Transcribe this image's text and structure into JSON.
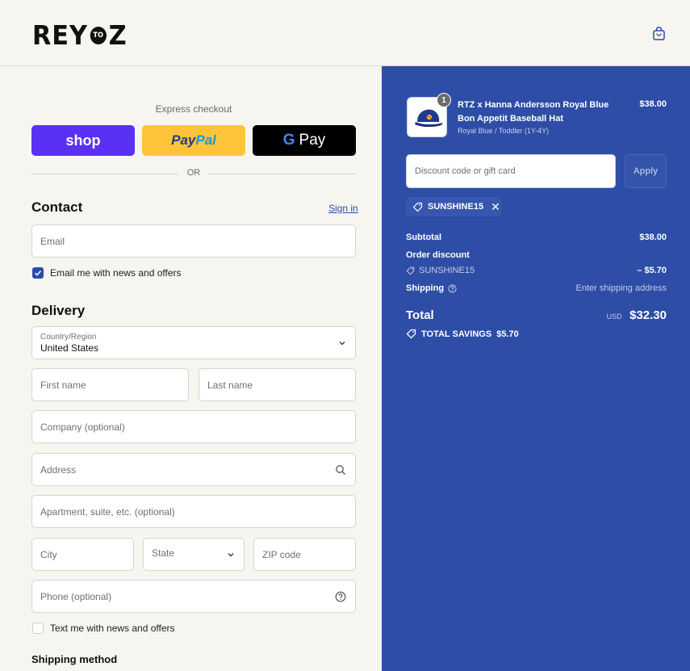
{
  "header": {
    "logo_left": "REY",
    "logo_middle": "TO",
    "logo_right": "Z",
    "cart_icon": "shopping-bag-icon"
  },
  "express": {
    "label": "Express checkout",
    "shop_label": "shop",
    "paypal_part1": "Pay",
    "paypal_part2": "Pal",
    "gpay_g": "G",
    "gpay_label": "Pay",
    "or_label": "OR"
  },
  "contact": {
    "heading": "Contact",
    "signin": "Sign in",
    "email_placeholder": "Email",
    "news_label": "Email me with news and offers",
    "news_checked": true
  },
  "delivery": {
    "heading": "Delivery",
    "country_label": "Country/Region",
    "country_value": "United States",
    "first_name": "First name",
    "last_name": "Last name",
    "company": "Company (optional)",
    "address": "Address",
    "apartment": "Apartment, suite, etc. (optional)",
    "city": "City",
    "state": "State",
    "zip": "ZIP code",
    "phone": "Phone (optional)",
    "text_label": "Text me with news and offers",
    "text_checked": false
  },
  "shipping_method": {
    "heading": "Shipping method"
  },
  "summary": {
    "product": {
      "quantity": "1",
      "name": "RTZ x Hanna Andersson Royal Blue Bon Appetit Baseball Hat",
      "variant": "Royal Blue / Toddler (1Y-4Y)",
      "price": "$38.00"
    },
    "discount_placeholder": "Discount code or gift card",
    "apply_label": "Apply",
    "applied_code": "SUNSHINE15",
    "subtotal_label": "Subtotal",
    "subtotal_value": "$38.00",
    "order_discount_label": "Order discount",
    "discount_code": "SUNSHINE15",
    "discount_value": "– $5.70",
    "shipping_label": "Shipping",
    "shipping_value": "Enter shipping address",
    "total_label": "Total",
    "total_currency": "USD",
    "total_value": "$32.30",
    "savings_label": "TOTAL SAVINGS",
    "savings_value": "$5.70"
  },
  "colors": {
    "summary_bg": "#2d4da6",
    "shop_purple": "#5a31f4",
    "paypal_yellow": "#ffc439",
    "accent_blue": "#2c4ba8"
  }
}
